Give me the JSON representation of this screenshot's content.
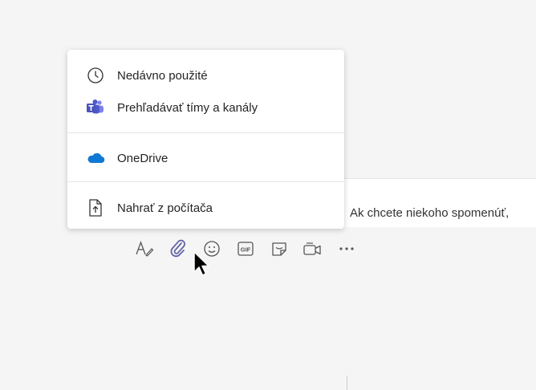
{
  "attach_menu": {
    "items": [
      {
        "label": "Nedávno použité",
        "icon": "clock-icon"
      },
      {
        "label": "Prehľadávať tímy a kanály",
        "icon": "teams-icon"
      },
      {
        "label": "OneDrive",
        "icon": "onedrive-cloud-icon"
      },
      {
        "label": "Nahrať z počítača",
        "icon": "upload-file-icon"
      }
    ]
  },
  "compose": {
    "placeholder_text": "Ak chcete niekoho spomenúť,"
  },
  "toolbar": {
    "buttons": [
      {
        "icon": "format-icon"
      },
      {
        "icon": "attach-icon"
      },
      {
        "icon": "emoji-icon"
      },
      {
        "icon": "gif-icon",
        "label": "GIF"
      },
      {
        "icon": "sticker-icon"
      },
      {
        "icon": "meet-now-icon"
      },
      {
        "icon": "more-options-icon"
      }
    ]
  },
  "colors": {
    "accent": "#6264a7",
    "onedrive": "#0f78d4",
    "text": "#242424"
  }
}
